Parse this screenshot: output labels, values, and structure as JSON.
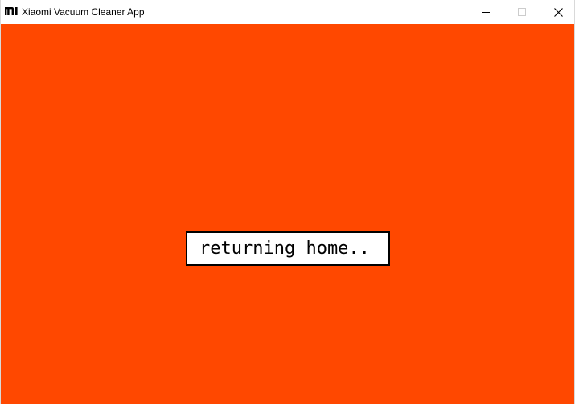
{
  "window": {
    "title": "Xiaomi Vacuum Cleaner App",
    "logo_icon": "mi-logo-icon",
    "controls": {
      "minimize_icon": "minimize-icon",
      "maximize_icon": "maximize-icon",
      "close_icon": "close-icon"
    }
  },
  "main": {
    "background_color": "#ff4800",
    "status_text": "returning home.."
  }
}
